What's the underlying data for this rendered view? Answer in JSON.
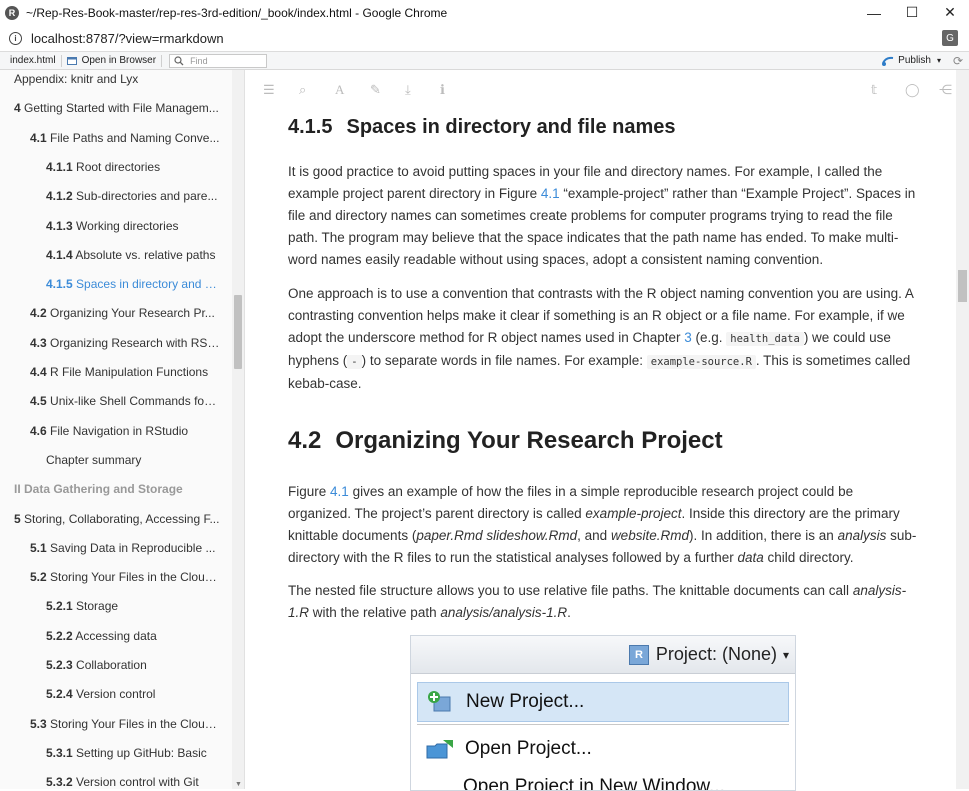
{
  "window": {
    "title": "~/Rep-Res-Book-master/rep-res-3rd-edition/_book/index.html - Google Chrome",
    "app_logo_letter": "R",
    "minimize_glyph": "—",
    "maximize_glyph": "☐",
    "close_glyph": "✕"
  },
  "addressbar": {
    "url": "localhost:8787/?view=rmarkdown",
    "info_glyph": "i",
    "translate_glyph": "G"
  },
  "viewer_toolbar": {
    "file": "index.html",
    "open_browser": "Open in Browser",
    "find_placeholder": "Find",
    "publish": "Publish",
    "publish_caret": "▾",
    "refresh_glyph": "⟳"
  },
  "book_toolbar_icons": [
    "☰",
    "⌕",
    "A",
    "✎",
    "⤓",
    "ℹ",
    "𝕥",
    "◯",
    "⋲"
  ],
  "toc": [
    {
      "num": "",
      "label": "Appendix: knitr and Lyx",
      "level": 1,
      "state": "normal"
    },
    {
      "num": "4",
      "label": " Getting Started with File Managem...",
      "level": 1,
      "state": "normal"
    },
    {
      "num": "4.1",
      "label": " File Paths and Naming Conve...",
      "level": 2,
      "state": "normal"
    },
    {
      "num": "4.1.1",
      "label": " Root directories",
      "level": 3,
      "state": "normal"
    },
    {
      "num": "4.1.2",
      "label": " Sub-directories and pare...",
      "level": 3,
      "state": "normal"
    },
    {
      "num": "4.1.3",
      "label": " Working directories",
      "level": 3,
      "state": "normal"
    },
    {
      "num": "4.1.4",
      "label": " Absolute vs. relative paths",
      "level": 3,
      "state": "normal"
    },
    {
      "num": "4.1.5",
      "label": " Spaces in directory and fi...",
      "level": 3,
      "state": "active"
    },
    {
      "num": "4.2",
      "label": " Organizing Your Research Pr...",
      "level": 2,
      "state": "normal"
    },
    {
      "num": "4.3",
      "label": " Organizing Research with RSt...",
      "level": 2,
      "state": "normal"
    },
    {
      "num": "4.4",
      "label": " R File Manipulation Functions",
      "level": 2,
      "state": "normal"
    },
    {
      "num": "4.5",
      "label": " Unix-like Shell Commands for ...",
      "level": 2,
      "state": "normal"
    },
    {
      "num": "4.6",
      "label": " File Navigation in RStudio",
      "level": 2,
      "state": "normal"
    },
    {
      "num": "",
      "label": "Chapter summary",
      "level": 3,
      "state": "normal"
    },
    {
      "num": "",
      "label": "II Data Gathering and Storage",
      "level": 1,
      "state": "part"
    },
    {
      "num": "5",
      "label": " Storing, Collaborating, Accessing F...",
      "level": 1,
      "state": "normal"
    },
    {
      "num": "5.1",
      "label": " Saving Data in Reproducible ...",
      "level": 2,
      "state": "normal"
    },
    {
      "num": "5.2",
      "label": " Storing Your Files in the Cloud...",
      "level": 2,
      "state": "normal"
    },
    {
      "num": "5.2.1",
      "label": " Storage",
      "level": 3,
      "state": "normal"
    },
    {
      "num": "5.2.2",
      "label": " Accessing data",
      "level": 3,
      "state": "normal"
    },
    {
      "num": "5.2.3",
      "label": " Collaboration",
      "level": 3,
      "state": "normal"
    },
    {
      "num": "5.2.4",
      "label": " Version control",
      "level": 3,
      "state": "normal"
    },
    {
      "num": "5.3",
      "label": " Storing Your Files in the Cloud...",
      "level": 2,
      "state": "normal"
    },
    {
      "num": "5.3.1",
      "label": " Setting up GitHub: Basic",
      "level": 3,
      "state": "normal"
    },
    {
      "num": "5.3.2",
      "label": " Version control with Git",
      "level": 3,
      "state": "normal"
    }
  ],
  "main": {
    "sec415_num": "4.1.5",
    "sec415_title": "Spaces in directory and file names",
    "p1a": "It is good practice to avoid putting spaces in your file and directory names. For example, I called the example project parent directory in Figure ",
    "p1_link": "4.1",
    "p1b": " “example-project” rather than “Example Project”. Spaces in file and directory names can sometimes create problems for computer programs trying to read the file path. The program may believe that the space indicates that the path name has ended. To make multi-word names easily readable without using spaces, adopt a consistent naming convention.",
    "p2a": "One approach is to use a convention that contrasts with the R object naming convention you are using. A contrasting convention helps make it clear if something is an R object or a file name. For example, if we adopt the underscore method for R object names used in Chapter ",
    "p2_link": "3",
    "p2b": " (e.g. ",
    "p2_code1": "health_data",
    "p2c": ") we could use hyphens (",
    "p2_code2": "-",
    "p2d": ") to separate words in file names. For example: ",
    "p2_code3": "example-source.R",
    "p2e": ". This is sometimes called kebab-case.",
    "sec42_num": "4.2",
    "sec42_title": "Organizing Your Research Project",
    "p3a": "Figure ",
    "p3_link": "4.1",
    "p3b": " gives an example of how the files in a simple reproducible research project could be organized. The project’s parent directory is called ",
    "p3_em1": "example-project",
    "p3c": ". Inside this directory are the primary knittable documents (",
    "p3_em2": "paper.Rmd slideshow.Rmd",
    "p3d": ", and ",
    "p3_em3": "website.Rmd",
    "p3e": "). In addition, there is an ",
    "p3_em4": "analysis",
    "p3f": " sub-directory with the R files to run the statistical analyses followed by a further ",
    "p3_em5": "data",
    "p3g": " child directory.",
    "p4a": "The nested file structure allows you to use relative file paths. The knittable documents can call ",
    "p4_em1": "analysis-1.R",
    "p4b": " with the relative path ",
    "p4_em2": "analysis/analysis-1.R",
    "p4c": "."
  },
  "figure": {
    "project_label": "Project: (None)",
    "project_caret": "▾",
    "cube_letter": "R",
    "new_project": "New Project...",
    "open_project": "Open Project...",
    "open_new_window": "Open Project in New Window..."
  },
  "scroll_arrow": "▼"
}
